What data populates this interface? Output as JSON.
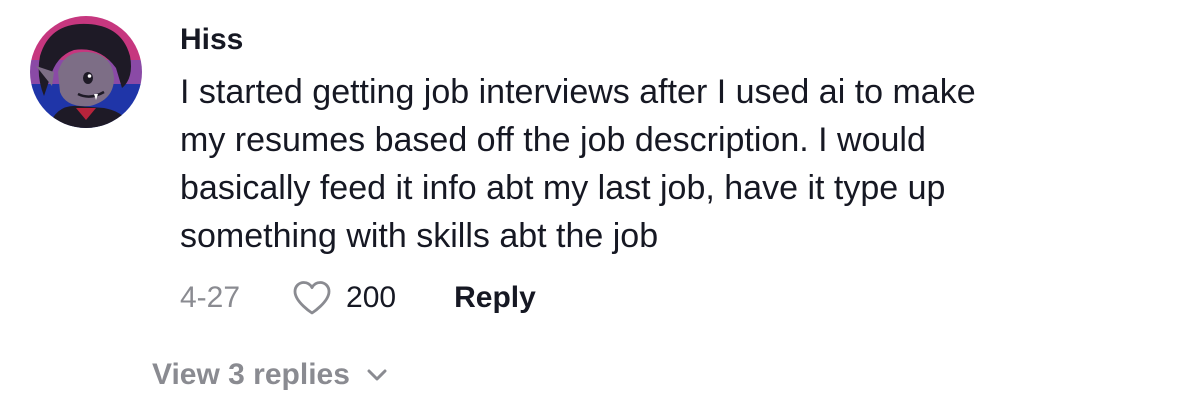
{
  "comment": {
    "username": "Hiss",
    "text_lines": [
      "I started getting job interviews after I used ai to make",
      "my resumes based off the job description. I would",
      "basically feed it info abt my last job, have it type up",
      "something with skills abt the job"
    ],
    "date": "4-27",
    "like_count": "200",
    "reply_label": "Reply",
    "view_replies_label": "View 3 replies",
    "icons": {
      "avatar": "avatar",
      "like": "heart-outline-icon",
      "expand": "chevron-down-icon"
    },
    "colors": {
      "primary_text": "#161823",
      "secondary_text": "#8a8b91"
    }
  }
}
